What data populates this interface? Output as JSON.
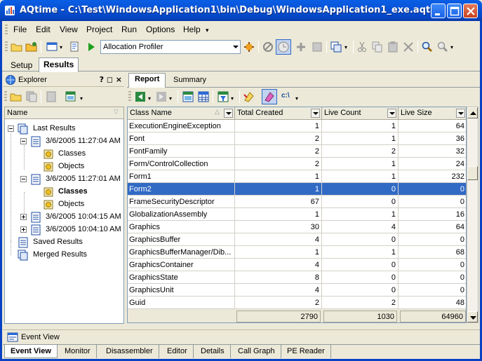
{
  "window": {
    "title": "AQtime - C:\\Test\\WindowsApplication1\\bin\\Debug\\WindowsApplication1_exe.aqt"
  },
  "menu": [
    "File",
    "Edit",
    "View",
    "Project",
    "Run",
    "Options",
    "Help"
  ],
  "toolbar": {
    "profiler": "Allocation Profiler"
  },
  "top_tabs": [
    "Setup",
    "Results"
  ],
  "explorer": {
    "title": "Explorer",
    "controls": "? ◻ ×",
    "column": "Name",
    "nodes": [
      {
        "label": "Last Results"
      },
      {
        "label": "3/6/2005 11:27:04 AM"
      },
      {
        "label": "Classes"
      },
      {
        "label": "Objects"
      },
      {
        "label": "3/6/2005 11:27:01 AM"
      },
      {
        "label": "Classes"
      },
      {
        "label": "Objects"
      },
      {
        "label": "3/6/2005 10:04:15 AM"
      },
      {
        "label": "3/6/2005 10:04:10 AM"
      },
      {
        "label": "Saved Results"
      },
      {
        "label": "Merged Results"
      }
    ]
  },
  "report_tabs": [
    "Report",
    "Summary"
  ],
  "grid": {
    "columns": [
      "Class Name",
      "Total Created",
      "Live Count",
      "Live Size"
    ],
    "rows": [
      [
        "ExecutionEngineException",
        "1",
        "1",
        "64"
      ],
      [
        "Font",
        "2",
        "1",
        "36"
      ],
      [
        "FontFamily",
        "2",
        "2",
        "32"
      ],
      [
        "Form/ControlCollection",
        "2",
        "1",
        "24"
      ],
      [
        "Form1",
        "1",
        "1",
        "232"
      ],
      [
        "Form2",
        "1",
        "0",
        "0"
      ],
      [
        "FrameSecurityDescriptor",
        "67",
        "0",
        "0"
      ],
      [
        "GlobalizationAssembly",
        "1",
        "1",
        "16"
      ],
      [
        "Graphics",
        "30",
        "4",
        "64"
      ],
      [
        "GraphicsBuffer",
        "4",
        "0",
        "0"
      ],
      [
        "GraphicsBufferManager/Dib...",
        "1",
        "1",
        "68"
      ],
      [
        "GraphicsContainer",
        "4",
        "0",
        "0"
      ],
      [
        "GraphicsState",
        "8",
        "0",
        "0"
      ],
      [
        "GraphicsUnit",
        "4",
        "0",
        "0"
      ],
      [
        "Guid",
        "2",
        "2",
        "48"
      ]
    ],
    "totals": [
      "2790",
      "1030",
      "64960"
    ]
  },
  "event_view": {
    "title": "Event View"
  },
  "bottom_tabs": [
    "Event View",
    "Monitor",
    "Disassembler",
    "Editor",
    "Details",
    "Call Graph",
    "PE Reader"
  ]
}
